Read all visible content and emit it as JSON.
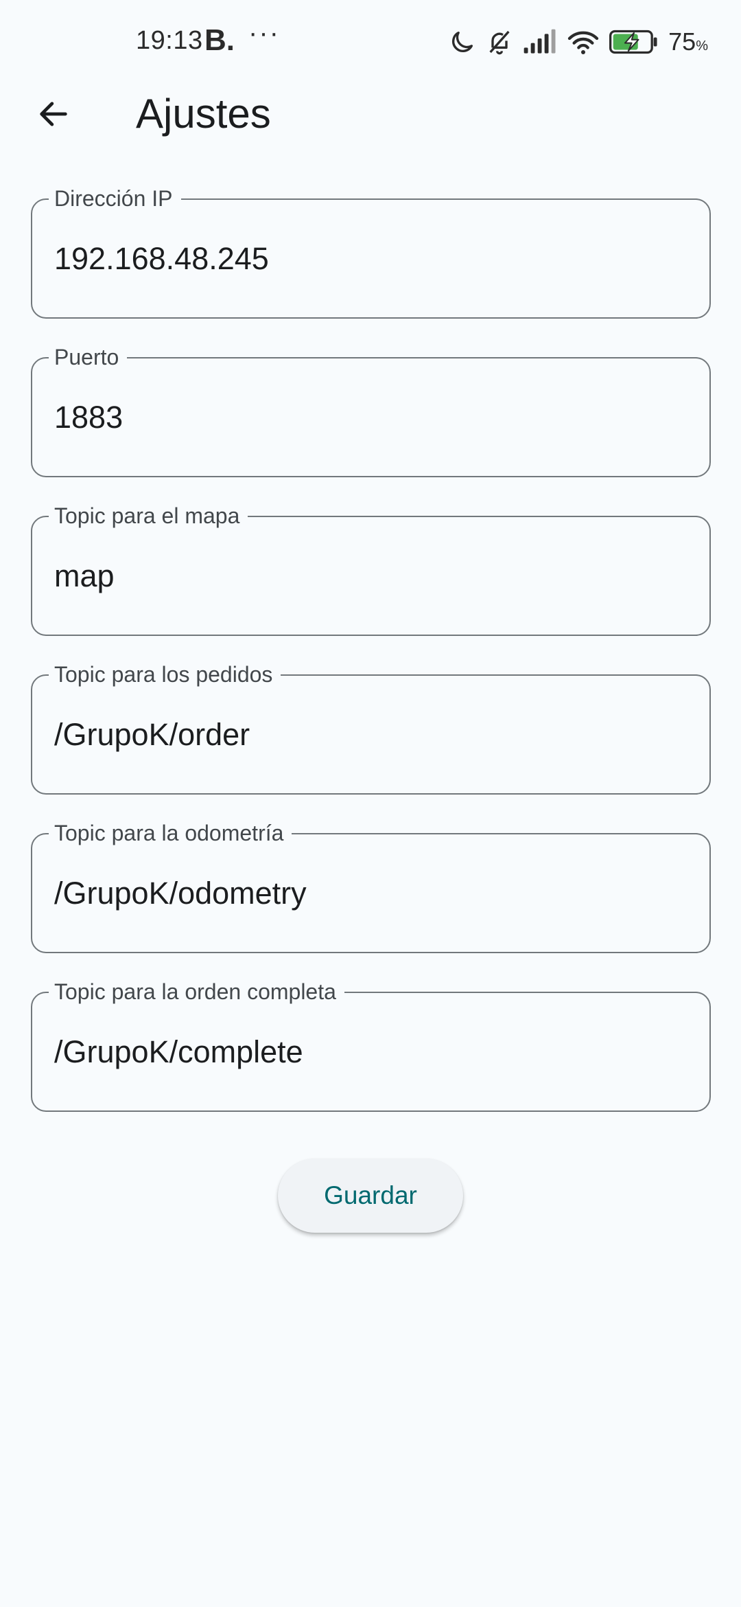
{
  "status_bar": {
    "time": "19:13",
    "b_badge": "B.",
    "more": "···",
    "battery_percent": "75",
    "battery_unit": "%",
    "icons": [
      "moon-icon",
      "bell-off-icon",
      "signal-icon",
      "wifi-icon",
      "battery-charging-icon"
    ]
  },
  "app_bar": {
    "back_icon": "arrow-back-icon",
    "title": "Ajustes"
  },
  "form": {
    "fields": [
      {
        "label": "Dirección IP",
        "value": "192.168.48.245"
      },
      {
        "label": "Puerto",
        "value": "1883"
      },
      {
        "label": "Topic para el mapa",
        "value": "map"
      },
      {
        "label": "Topic para los pedidos",
        "value": "/GrupoK/order"
      },
      {
        "label": "Topic para la odometría",
        "value": "/GrupoK/odometry"
      },
      {
        "label": "Topic para la orden completa",
        "value": "/GrupoK/complete"
      }
    ],
    "save_label": "Guardar"
  },
  "colors": {
    "background": "#f8fbfd",
    "outline": "#72787c",
    "accent": "#00696f",
    "battery_green": "#4caf50"
  }
}
